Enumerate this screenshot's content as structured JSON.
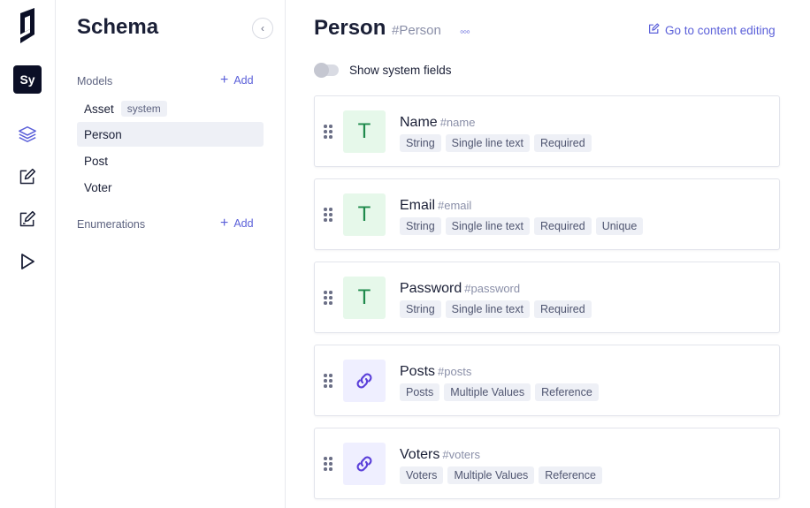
{
  "rail": {
    "project_initials": "Sy",
    "nav_icons": [
      "schema-layers-icon",
      "content-edit-icon",
      "content-edit-alt-icon",
      "playground-play-icon"
    ]
  },
  "sidebar": {
    "title": "Schema",
    "models_label": "Models",
    "add_label": "Add",
    "models": [
      {
        "label": "Asset",
        "chip": "system"
      },
      {
        "label": "Person",
        "chip": null
      },
      {
        "label": "Post",
        "chip": null
      },
      {
        "label": "Voter",
        "chip": null
      }
    ],
    "enumerations_label": "Enumerations",
    "enum_add_label": "Add"
  },
  "main": {
    "title": "Person",
    "api_id": "#Person",
    "goto_label": "Go to content editing",
    "toggle_label": "Show system fields",
    "toggle_on": false,
    "fields": [
      {
        "name": "Name",
        "api": "#name",
        "icon": "text-field-icon",
        "icon_glyph": "T",
        "tags": [
          "String",
          "Single line text",
          "Required"
        ]
      },
      {
        "name": "Email",
        "api": "#email",
        "icon": "text-field-icon",
        "icon_glyph": "T",
        "tags": [
          "String",
          "Single line text",
          "Required",
          "Unique"
        ]
      },
      {
        "name": "Password",
        "api": "#password",
        "icon": "text-field-icon",
        "icon_glyph": "T",
        "tags": [
          "String",
          "Single line text",
          "Required"
        ]
      },
      {
        "name": "Posts",
        "api": "#posts",
        "icon": "link-chain-icon",
        "icon_glyph": "",
        "tags": [
          "Posts",
          "Multiple Values",
          "Reference"
        ]
      },
      {
        "name": "Voters",
        "api": "#voters",
        "icon": "link-chain-icon",
        "icon_glyph": "",
        "tags": [
          "Voters",
          "Multiple Values",
          "Reference"
        ]
      }
    ]
  },
  "colors": {
    "accent": "#5a5fd9",
    "text_icon_bg": "#e6f8ea",
    "text_icon_fg": "#1f8a4c",
    "relation_icon_bg": "#efefff",
    "project_badge_bg": "#0b0f26"
  }
}
